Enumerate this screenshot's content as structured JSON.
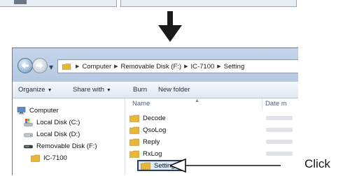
{
  "address_bar": {
    "crumbs": [
      "Computer",
      "Removable Disk (F:)",
      "IC-7100",
      "Setting"
    ]
  },
  "toolbar": {
    "organize": "Organize",
    "share_with": "Share with",
    "burn": "Burn",
    "new_folder": "New folder"
  },
  "nav_pane": {
    "items": [
      {
        "label": "Computer",
        "icon": "computer-icon"
      },
      {
        "label": "Local Disk (C:)",
        "icon": "os-drive-icon"
      },
      {
        "label": "Local Disk (D:)",
        "icon": "drive-icon"
      },
      {
        "label": "Removable Disk (F:)",
        "icon": "removable-drive-icon"
      },
      {
        "label": "IC-7100",
        "icon": "folder-icon"
      }
    ]
  },
  "content": {
    "columns": {
      "name": "Name",
      "date": "Date m"
    },
    "files": [
      "Decode",
      "QsoLog",
      "Reply",
      "RxLog",
      "Setting"
    ],
    "selected": "Setting"
  },
  "annotation": {
    "label": "Click"
  },
  "colors": {
    "folder": "#e8b73a",
    "title_bar": "#c4d5ea",
    "selection_border": "#2a3f58"
  }
}
